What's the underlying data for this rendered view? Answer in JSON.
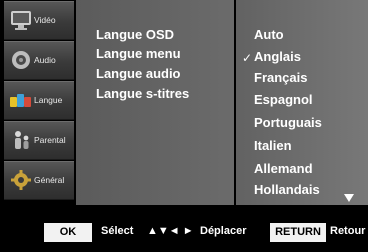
{
  "sidebar": {
    "items": [
      {
        "label": "Vidéo",
        "icon": "tv-monitor-icon"
      },
      {
        "label": "Audio",
        "icon": "speaker-icon"
      },
      {
        "label": "Langue",
        "icon": "abc-letters-icon"
      },
      {
        "label": "Parental",
        "icon": "parental-figures-icon"
      },
      {
        "label": "Général",
        "icon": "gear-icon"
      }
    ]
  },
  "menu": {
    "items": [
      "Langue OSD",
      "Langue menu",
      "Langue audio",
      "Langue s-titres"
    ],
    "active": "Langue menu"
  },
  "options": {
    "items": [
      "Auto",
      "Anglais",
      "Français",
      "Espagnol",
      "Portuguais",
      "Italien",
      "Allemand",
      "Hollandais"
    ],
    "selected": "Anglais",
    "more_indicator": "scroll-down-arrow-icon"
  },
  "footer": {
    "ok_label": "OK",
    "select_text": "Sélect",
    "nav_arrows": "▲▼◄ ►",
    "move_text": "Déplacer",
    "return_label": "RETURN",
    "return_text": "Retour"
  }
}
